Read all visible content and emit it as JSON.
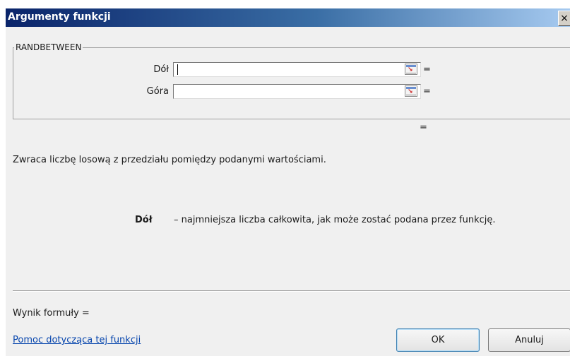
{
  "window": {
    "title": "Argumenty funkcji",
    "close_glyph": "×"
  },
  "function": {
    "name": "RANDBETWEEN"
  },
  "arguments": [
    {
      "label": "Dół",
      "value": "",
      "result": "="
    },
    {
      "label": "Góra",
      "value": "",
      "result": "="
    }
  ],
  "overall_result": "=",
  "description": "Zwraca liczbę losową z przedziału pomiędzy podanymi wartościami.",
  "argument_help": {
    "name": "Dół",
    "text": "– najmniejsza liczba całkowita, jak może zostać podana przez funkcję."
  },
  "formula_result": {
    "label": "Wynik formuły ="
  },
  "help_link": "Pomoc dotycząca tej funkcji",
  "buttons": {
    "ok": "OK",
    "cancel": "Anuluj"
  }
}
